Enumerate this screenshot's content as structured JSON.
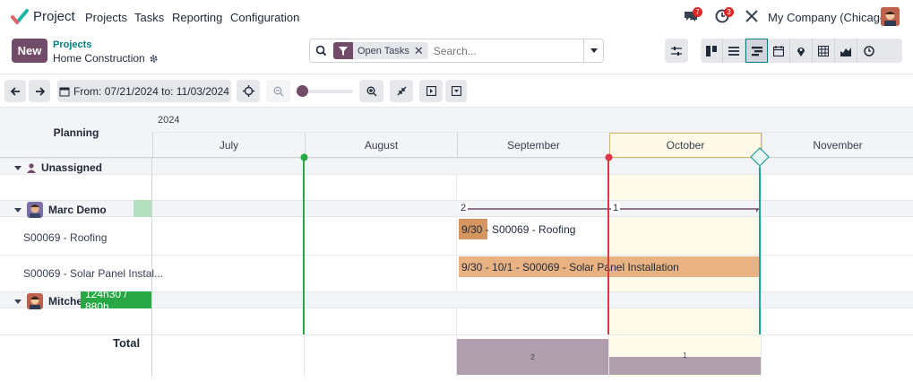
{
  "navbar": {
    "app_name": "Project",
    "menu": [
      "Projects",
      "Tasks",
      "Reporting",
      "Configuration"
    ],
    "messages_count": "7",
    "activities_count": "3",
    "company": "My Company (Chicago)"
  },
  "control_panel": {
    "new_label": "New",
    "breadcrumb_parent": "Projects",
    "breadcrumb_current": "Home Construction",
    "filter_facet": "Open Tasks",
    "search_placeholder": "Search..."
  },
  "toolbar": {
    "date_range": "From: 07/21/2024 to: 11/03/2024"
  },
  "gantt": {
    "planning_header": "Planning",
    "year": "2024",
    "months": [
      "July",
      "August",
      "September",
      "October",
      "November"
    ],
    "groups": {
      "unassigned": "Unassigned",
      "marc": "Marc Demo",
      "mitchell": "Mitche"
    },
    "rows": {
      "roofing": "S00069 - Roofing",
      "solar": "S00069 - Solar Panel Instal..."
    },
    "pills": {
      "roofing": "9/30 - S00069 - Roofing",
      "solar": "9/30 - 10/1 - S00069 - Solar Panel Installation"
    },
    "group_counts": [
      "2",
      "1"
    ],
    "allocation": "124h30 / 880h",
    "total_label": "Total",
    "totals": [
      {
        "month": "September",
        "count": 2
      },
      {
        "month": "October",
        "count": 1
      }
    ]
  }
}
